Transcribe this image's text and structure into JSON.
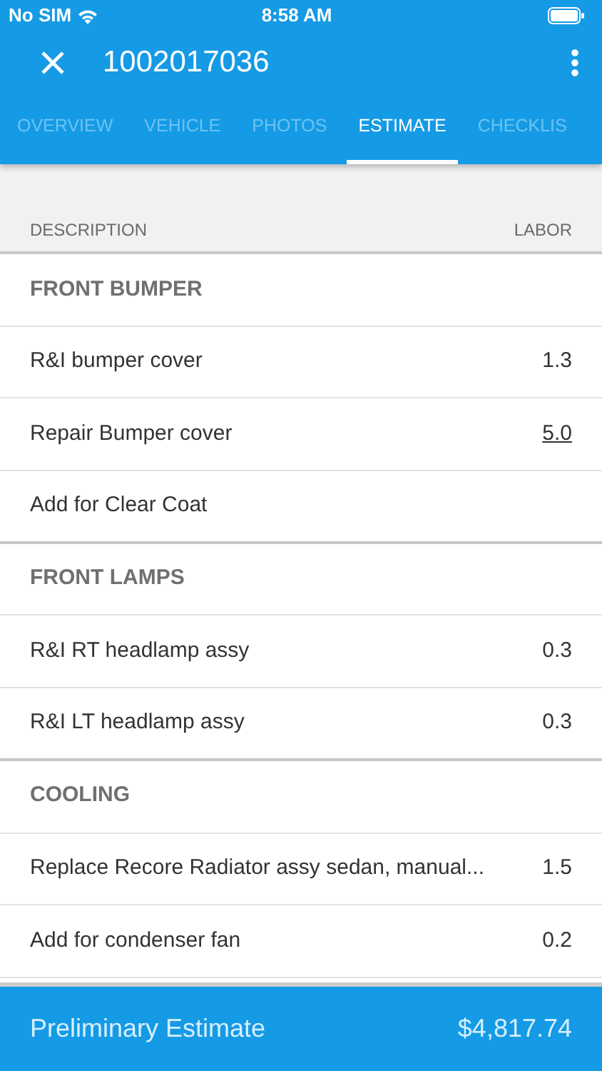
{
  "status_bar": {
    "carrier": "No SIM",
    "time": "8:58 AM"
  },
  "app_bar": {
    "title": "1002017036"
  },
  "tabs": [
    {
      "label": "OVERVIEW",
      "selected": false
    },
    {
      "label": "VEHICLE",
      "selected": false
    },
    {
      "label": "PHOTOS",
      "selected": false
    },
    {
      "label": "ESTIMATE",
      "selected": true
    },
    {
      "label": "CHECKLIS",
      "selected": false
    }
  ],
  "table": {
    "columns": [
      "DESCRIPTION",
      "LABOR"
    ],
    "sections": [
      {
        "title": "FRONT BUMPER",
        "items": [
          {
            "description": "R&I bumper cover",
            "labor": "1.3",
            "underlined": false
          },
          {
            "description": "Repair Bumper cover",
            "labor": "5.0",
            "underlined": true
          },
          {
            "description": "Add for Clear Coat"
          }
        ]
      },
      {
        "title": "FRONT LAMPS",
        "items": [
          {
            "description": "R&I RT headlamp assy",
            "labor": "0.3",
            "underlined": false
          },
          {
            "description": "R&I LT headlamp assy",
            "labor": "0.3",
            "underlined": false
          }
        ]
      },
      {
        "title": "COOLING",
        "items": [
          {
            "description": "Replace Recore Radiator assy sedan, manual...",
            "labor": "1.5",
            "underlined": false
          },
          {
            "description": "Add for condenser fan",
            "labor": "0.2",
            "underlined": false
          }
        ]
      }
    ]
  },
  "footer": {
    "label": "Preliminary Estimate",
    "total": "$4,817.74"
  }
}
